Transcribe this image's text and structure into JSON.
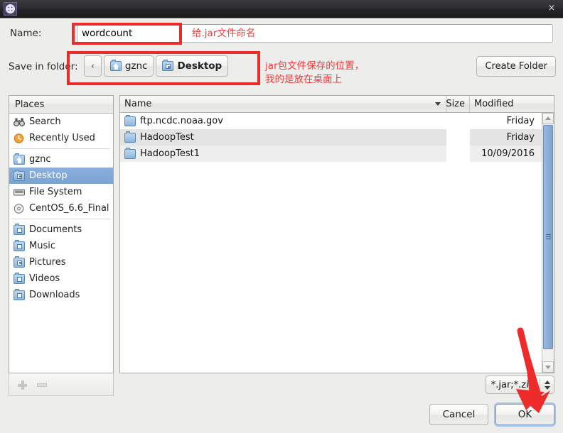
{
  "titlebar": {
    "icon": "gear-icon",
    "title": "",
    "close_label": "×"
  },
  "name_row": {
    "label": "Name:",
    "value": "wordcount",
    "placeholder": ""
  },
  "folder_row": {
    "label": "Save in folder:",
    "back_label": "‹",
    "crumbs": [
      {
        "label": "gznc",
        "icon": "home-folder-icon",
        "active": false
      },
      {
        "label": "Desktop",
        "icon": "desktop-folder-icon",
        "active": true
      }
    ],
    "create_folder_label": "Create Folder"
  },
  "places": {
    "header": "Places",
    "items": [
      {
        "label": "Search",
        "icon": "binoculars-icon",
        "selected": false
      },
      {
        "label": "Recently Used",
        "icon": "recent-clock-icon",
        "selected": false
      },
      {
        "label": "gznc",
        "icon": "home-folder-icon",
        "selected": false
      },
      {
        "label": "Desktop",
        "icon": "desktop-folder-icon",
        "selected": true
      },
      {
        "label": "File System",
        "icon": "drive-icon",
        "selected": false
      },
      {
        "label": "CentOS_6.6_Final",
        "icon": "disc-icon",
        "selected": false
      },
      {
        "label": "Documents",
        "icon": "documents-folder-icon",
        "selected": false
      },
      {
        "label": "Music",
        "icon": "music-folder-icon",
        "selected": false
      },
      {
        "label": "Pictures",
        "icon": "pictures-folder-icon",
        "selected": false
      },
      {
        "label": "Videos",
        "icon": "videos-folder-icon",
        "selected": false
      },
      {
        "label": "Downloads",
        "icon": "downloads-folder-icon",
        "selected": false
      }
    ],
    "add_label": "+",
    "remove_label": "−"
  },
  "filelist": {
    "columns": [
      "Name",
      "Size",
      "Modified"
    ],
    "sort_indicator": "chevron-down-icon",
    "rows": [
      {
        "name": "ftp.ncdc.noaa.gov",
        "size": "",
        "modified": "Friday"
      },
      {
        "name": "HadoopTest",
        "size": "",
        "modified": "Friday"
      },
      {
        "name": "HadoopTest1",
        "size": "",
        "modified": "10/09/2016"
      }
    ]
  },
  "filter": {
    "value": "*.jar;*.zip"
  },
  "actions": {
    "cancel_label": "Cancel",
    "ok_label": "OK"
  },
  "annotations": {
    "name_note": "给.jar文件命名",
    "folder_note": "jar包文件保存的位置，\n我的是放在桌面上",
    "color": "#f33a3a"
  }
}
